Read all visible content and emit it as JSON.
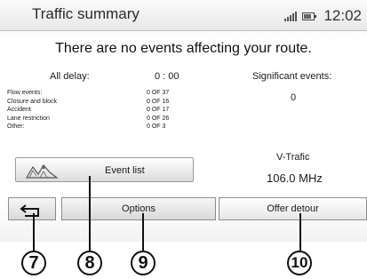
{
  "header": {
    "title": "Traffic summary",
    "time": "12:02"
  },
  "status": {
    "signal_icon": "signal-icon",
    "battery_icon": "battery-icon"
  },
  "headline": "There are no events affecting your route.",
  "summary": {
    "all_delay_label": "All delay:",
    "all_delay_value": "0 : 00",
    "significant_label": "Significant events:",
    "significant_value": "0"
  },
  "events": [
    {
      "label": "Flow events:",
      "value": "0 OF 37"
    },
    {
      "label": "Closure and block",
      "value": "0 OF 16"
    },
    {
      "label": "Accident",
      "value": "0 OF 17"
    },
    {
      "label": "Lane restriction",
      "value": "0 OF 26"
    },
    {
      "label": "Other:",
      "value": "0 OF 3"
    }
  ],
  "event_list_button": {
    "label": "Event list",
    "icon": "traffic-map-icon"
  },
  "radio": {
    "station": "V-Trafic",
    "frequency": "106.0 MHz"
  },
  "bottom_bar": {
    "back_icon": "back-arrow-icon",
    "options_label": "Options",
    "detour_label": "Offer detour"
  },
  "callouts": [
    "7",
    "8",
    "9",
    "10"
  ]
}
